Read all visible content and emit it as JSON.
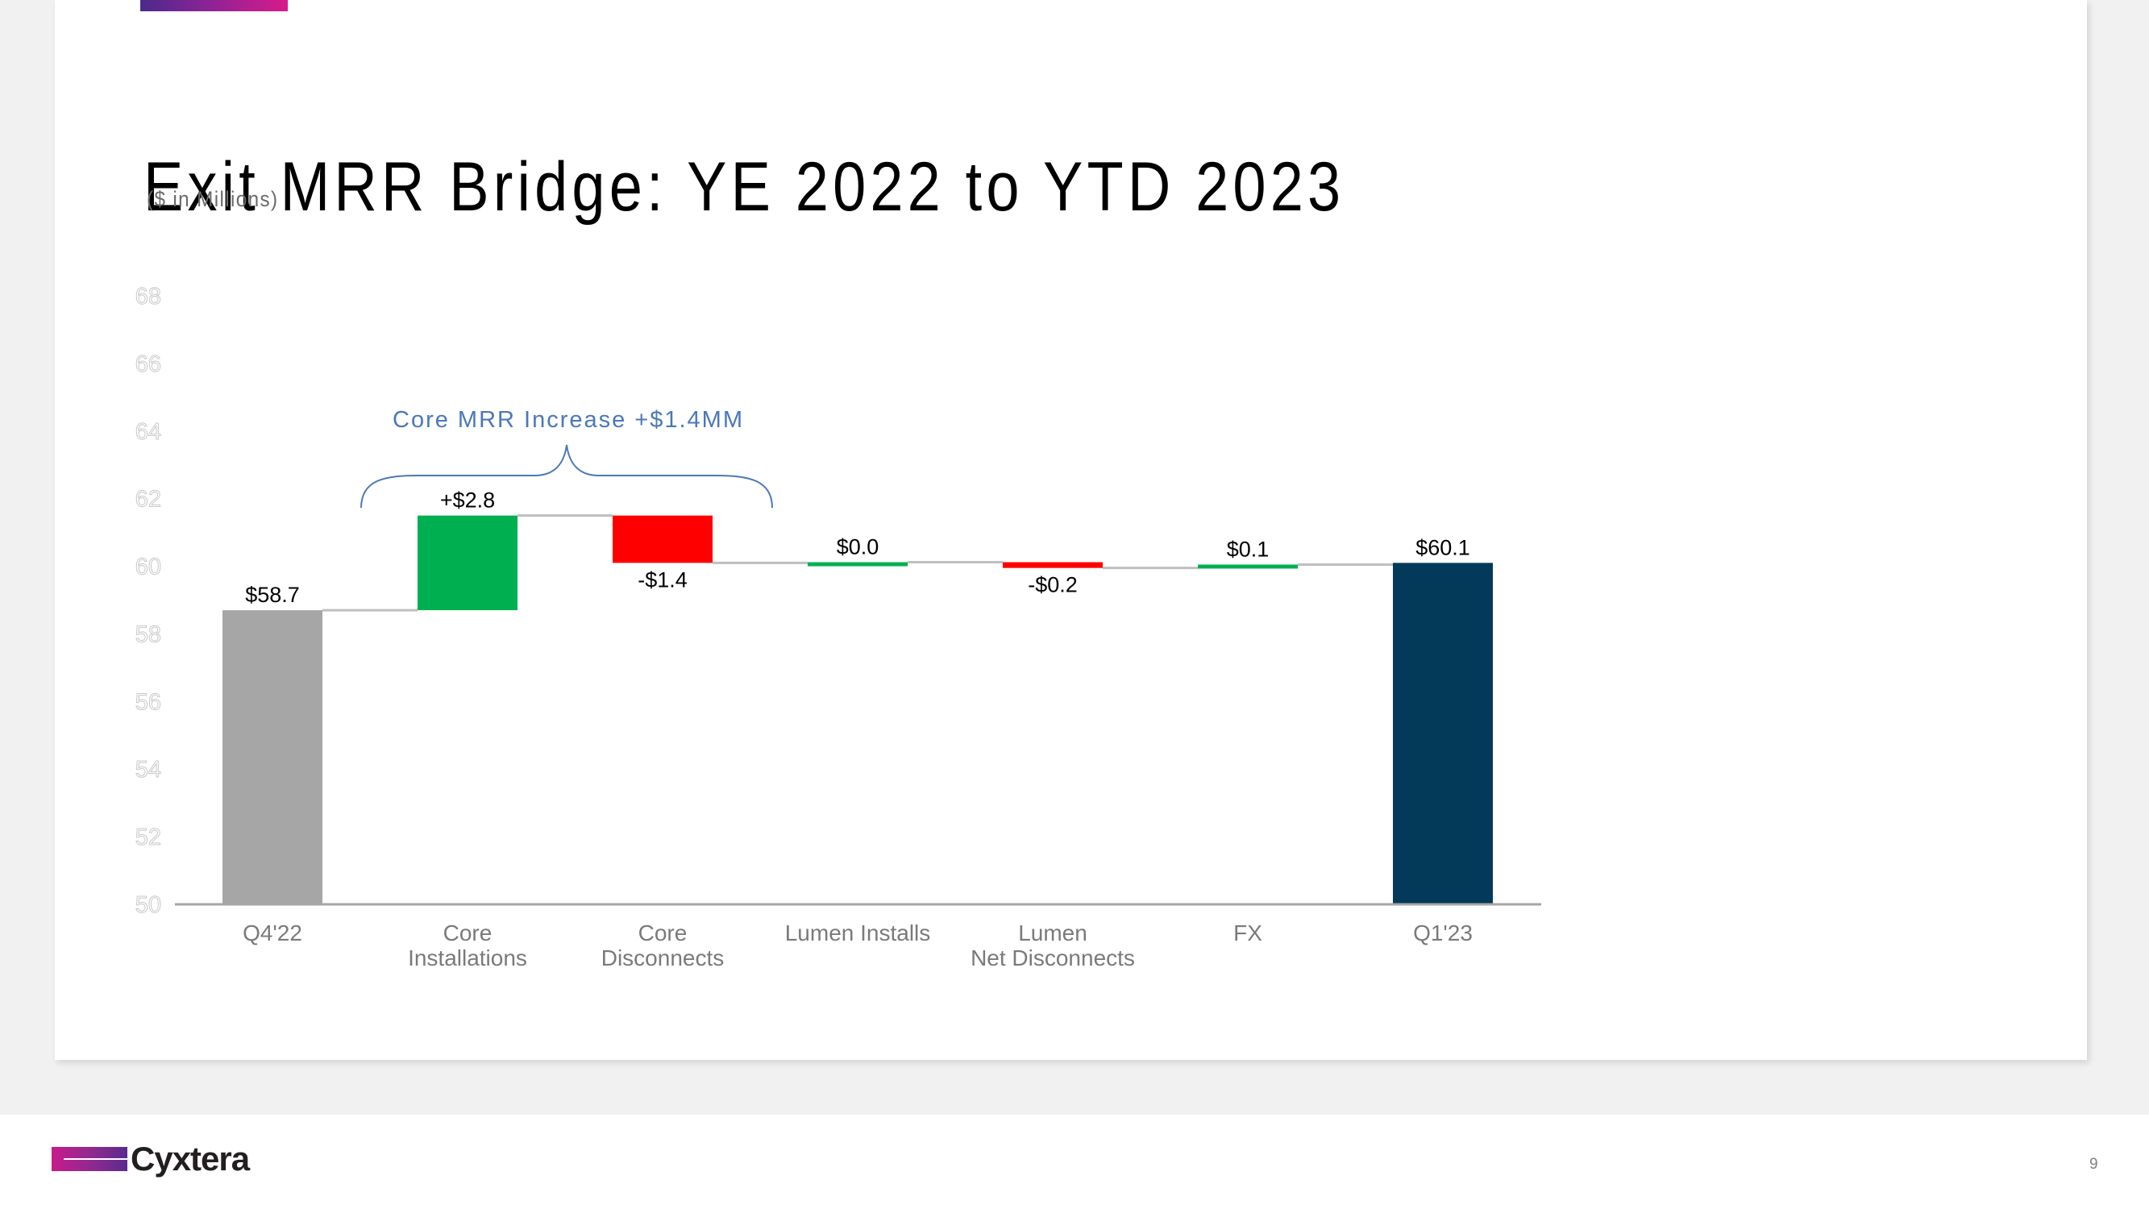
{
  "slide": {
    "title": "Exit MRR Bridge: YE 2022 to YTD 2023",
    "subtitle": "($ in Millions)",
    "page_number": "9",
    "brand": "Cyxtera",
    "accent_colors": {
      "purple": "#4b2a8c",
      "magenta": "#d81b8c"
    }
  },
  "chart_data": {
    "type": "bar",
    "subtype": "waterfall",
    "title": "Exit MRR Bridge: YE 2022 to YTD 2023",
    "ylabel": "$ in Millions",
    "xlabel": "",
    "ylim": [
      50,
      68
    ],
    "yticks": [
      50,
      52,
      54,
      56,
      58,
      60,
      62,
      64,
      66,
      68
    ],
    "grid": false,
    "legend": "none",
    "categories": [
      [
        "Q4'22"
      ],
      [
        "Core",
        "Installations"
      ],
      [
        "Core",
        "Disconnects"
      ],
      [
        "Lumen Installs"
      ],
      [
        "Lumen",
        "Net Disconnects"
      ],
      [
        "FX"
      ],
      [
        "Q1'23"
      ]
    ],
    "steps": [
      {
        "kind": "total",
        "value": 58.7,
        "label": "$58.7",
        "color": "#a6a6a6"
      },
      {
        "kind": "delta",
        "value": 2.8,
        "label": "+$2.8",
        "color": "#00b050"
      },
      {
        "kind": "delta",
        "value": -1.4,
        "label": "-$1.4",
        "color": "#ff0000"
      },
      {
        "kind": "delta",
        "value": 0.02,
        "label": "$0.0",
        "color": "#00b050"
      },
      {
        "kind": "delta",
        "value": -0.17,
        "label": "-$0.2",
        "color": "#ff0000"
      },
      {
        "kind": "delta",
        "value": 0.1,
        "label": "$0.1",
        "color": "#00b050"
      },
      {
        "kind": "total",
        "value": 60.1,
        "label": "$60.1",
        "color": "#033a5a"
      }
    ],
    "connector_color": "#bfbfbf",
    "annotations": [
      {
        "text": "Core MRR Increase +$1.4MM",
        "spans": [
          1,
          2
        ],
        "type": "brace",
        "color": "#4a78b8"
      }
    ]
  }
}
